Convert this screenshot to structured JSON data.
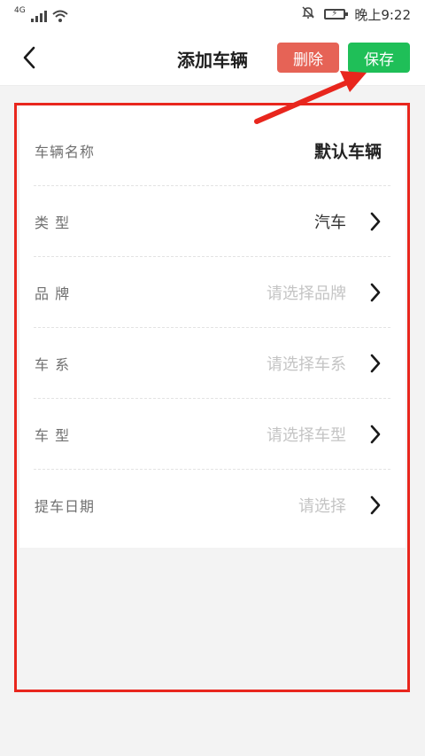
{
  "status_bar": {
    "network": "4G",
    "time": "晚上9:22"
  },
  "nav": {
    "title": "添加车辆",
    "delete_label": "删除",
    "save_label": "保存"
  },
  "form": {
    "rows": [
      {
        "label": "车辆名称",
        "value": "默认车辆"
      },
      {
        "label": "类 型",
        "value": "汽车"
      },
      {
        "label": "品 牌",
        "placeholder": "请选择品牌"
      },
      {
        "label": "车 系",
        "placeholder": "请选择车系"
      },
      {
        "label": "车 型",
        "placeholder": "请选择车型"
      },
      {
        "label": "提车日期",
        "placeholder": "请选择"
      }
    ]
  },
  "colors": {
    "delete": "#e66356",
    "save": "#1fbf58",
    "annotation": "#e8261d"
  }
}
